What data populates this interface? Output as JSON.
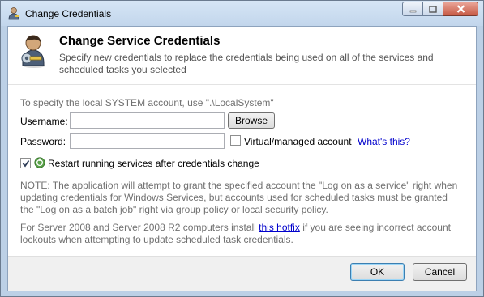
{
  "window": {
    "title": "Change Credentials"
  },
  "header": {
    "title": "Change Service Credentials",
    "description": "Specify new credentials to replace the credentials being used on all of the services and scheduled tasks you selected"
  },
  "form": {
    "hint": "To specify the local SYSTEM account, use \".\\LocalSystem\"",
    "username_label": "Username:",
    "username_value": "",
    "browse_label": "Browse",
    "password_label": "Password:",
    "password_value": "",
    "virtual_account_label": "Virtual/managed account",
    "virtual_account_checked": false,
    "whats_this_label": "What's this?",
    "restart_label": "Restart running services after credentials change",
    "restart_checked": true
  },
  "notes": {
    "note1": "NOTE: The application will attempt to grant the specified account the \"Log on as a service\" right when updating credentials for Windows Services, but accounts used for scheduled tasks must be granted the \"Log on as a batch job\" right via group policy or local security policy.",
    "note2_before": "For Server 2008 and Server 2008 R2 computers install ",
    "note2_link": "this hotfix",
    "note2_after": " if you are seeing incorrect account lockouts when attempting to update scheduled task credentials."
  },
  "footer": {
    "ok_label": "OK",
    "cancel_label": "Cancel"
  },
  "icons": {
    "title": "user-key-icon",
    "header": "user-credentials-icon",
    "restart": "restart-services-icon"
  }
}
